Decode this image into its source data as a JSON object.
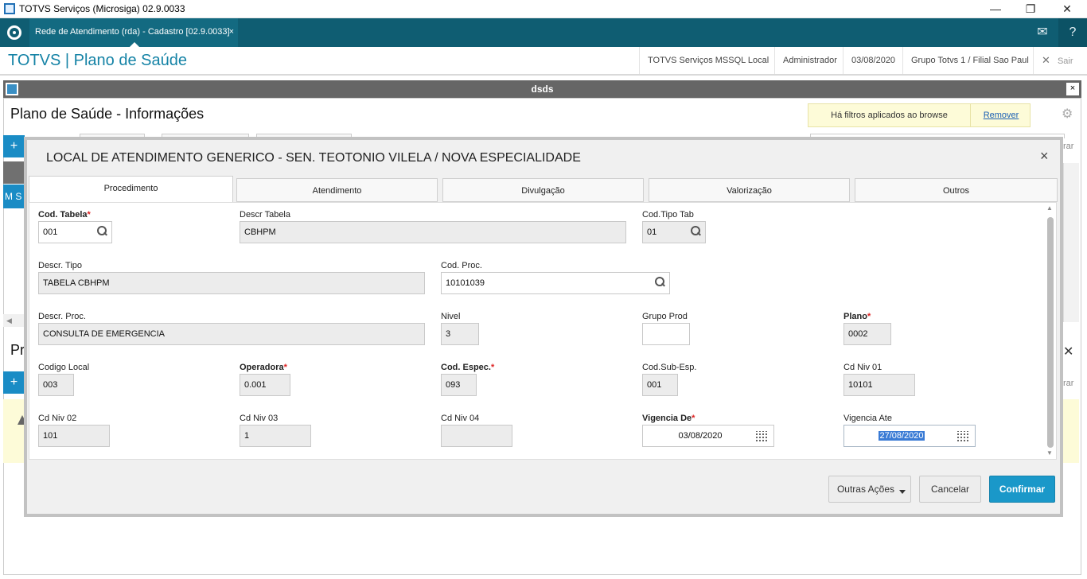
{
  "window": {
    "title": "TOTVS Serviços (Microsiga) 02.9.0033",
    "minimize": "—",
    "restore": "❐",
    "close": "✕"
  },
  "tabbar": {
    "tab_label": "Rede de Atendimento (rda) - Cadastro [02.9.0033]",
    "tab_close": "×",
    "mail_icon": "✉",
    "help_icon": "?"
  },
  "header": {
    "brand": "TOTVS | Plano de Saúde",
    "environment": "TOTVS Serviços MSSQL Local",
    "user": "Administrador",
    "date": "03/08/2020",
    "branch": "Grupo Totvs 1 / Filial Sao Paul",
    "exit_icon": "✕",
    "exit_label": "Sair"
  },
  "inner_window": {
    "title": "dsds",
    "close": "×"
  },
  "page": {
    "title": "Plano de Saúde - Informações",
    "filter_notice": "Há filtros aplicados ao browse",
    "filter_remove": "Remover",
    "gear_icon": "⚙"
  },
  "background": {
    "add_symbol": "+",
    "row_fragment": "M S",
    "section_fragment": "Pr",
    "right_fragment": "rar",
    "close_symbol": "✕"
  },
  "modal": {
    "title": "LOCAL DE ATENDIMENTO GENERICO - SEN. TEOTONIO VILELA / NOVA ESPECIALIDADE",
    "close": "×",
    "tabs": [
      "Procedimento",
      "Atendimento",
      "Divulgação",
      "Valorização",
      "Outros"
    ],
    "fields": {
      "cod_tabela": {
        "label": "Cod. Tabela",
        "value": "001"
      },
      "descr_tabela": {
        "label": "Descr Tabela",
        "value": "CBHPM"
      },
      "cod_tipo_tab": {
        "label": "Cod.Tipo Tab",
        "value": "01"
      },
      "descr_tipo": {
        "label": "Descr. Tipo",
        "value": "TABELA CBHPM"
      },
      "cod_proc": {
        "label": "Cod. Proc.",
        "value": "10101039"
      },
      "descr_proc": {
        "label": "Descr. Proc.",
        "value": "CONSULTA DE EMERGENCIA"
      },
      "nivel": {
        "label": "Nivel",
        "value": "3"
      },
      "grupo_prod": {
        "label": "Grupo Prod",
        "value": ""
      },
      "plano": {
        "label": "Plano",
        "value": "0002"
      },
      "codigo_local": {
        "label": "Codigo Local",
        "value": "003"
      },
      "operadora": {
        "label": "Operadora",
        "value": "0.001"
      },
      "cod_espec": {
        "label": "Cod. Espec.",
        "value": "093"
      },
      "cod_sub_esp": {
        "label": "Cod.Sub-Esp.",
        "value": "001"
      },
      "cd_niv_01": {
        "label": "Cd Niv 01",
        "value": "10101"
      },
      "cd_niv_02": {
        "label": "Cd Niv 02",
        "value": "101"
      },
      "cd_niv_03": {
        "label": "Cd Niv 03",
        "value": "1"
      },
      "cd_niv_04": {
        "label": "Cd Niv 04",
        "value": ""
      },
      "vigencia_de": {
        "label": "Vigencia De",
        "value": "03/08/2020"
      },
      "vigencia_ate": {
        "label": "Vigencia Ate",
        "value": "27/08/2020"
      }
    },
    "required_mark": "*",
    "buttons": {
      "other_actions": "Outras Ações",
      "cancel": "Cancelar",
      "confirm": "Confirmar"
    }
  }
}
